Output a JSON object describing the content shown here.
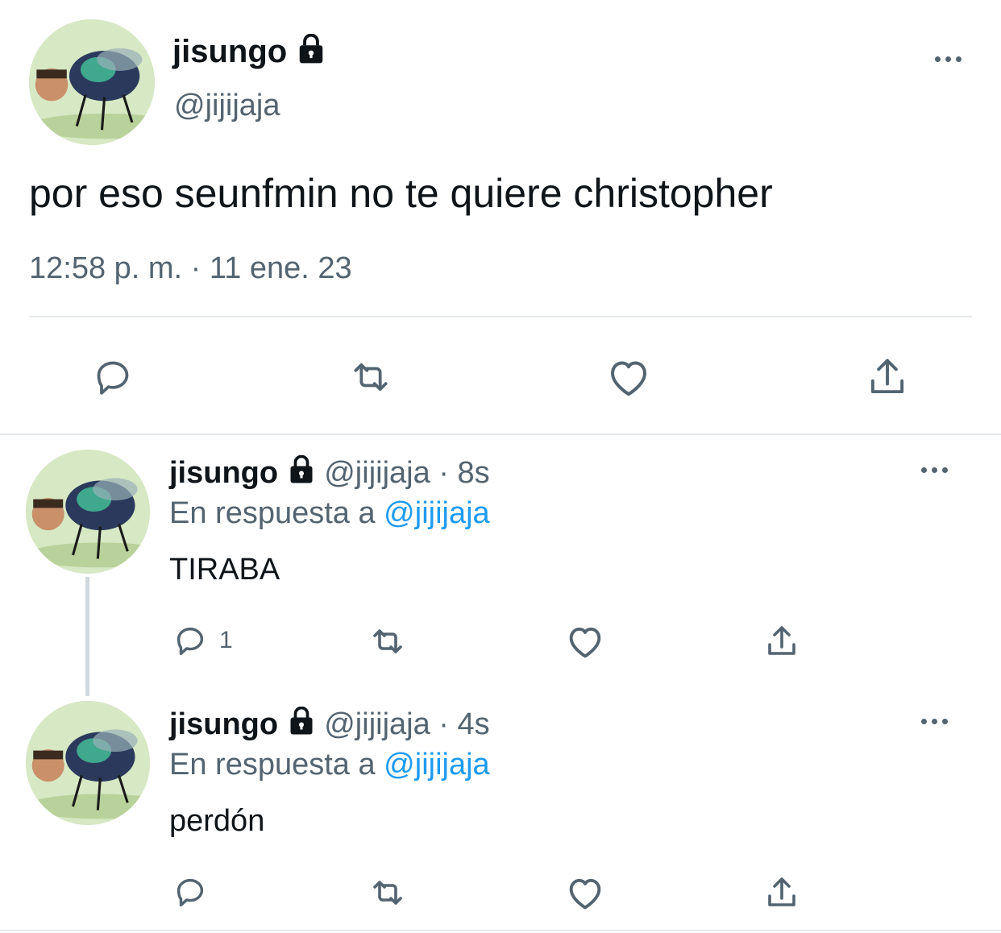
{
  "main_tweet": {
    "display_name": "jisungo",
    "handle": "@jijijaja",
    "text": "por eso seunfmin no te quiere christopher",
    "timestamp": "12:58 p. m. · 11 ene. 23",
    "icons": [
      "lock-icon",
      "more-icon",
      "reply-icon",
      "retweet-icon",
      "like-icon",
      "share-icon"
    ]
  },
  "replies": [
    {
      "display_name": "jisungo",
      "handle": "@jijijaja",
      "time": "· 8s",
      "reply_prefix": "En respuesta a",
      "reply_to": "@jijijaja",
      "text": "TIRABA",
      "reply_count": "1"
    },
    {
      "display_name": "jisungo",
      "handle": "@jijijaja",
      "time": "· 4s",
      "reply_prefix": "En respuesta a",
      "reply_to": "@jijijaja",
      "text": "perdón",
      "reply_count": ""
    }
  ],
  "colors": {
    "text": "#0f1419",
    "secondary": "#536471",
    "accent": "#1d9bf0",
    "divider": "#e6e9ec"
  }
}
